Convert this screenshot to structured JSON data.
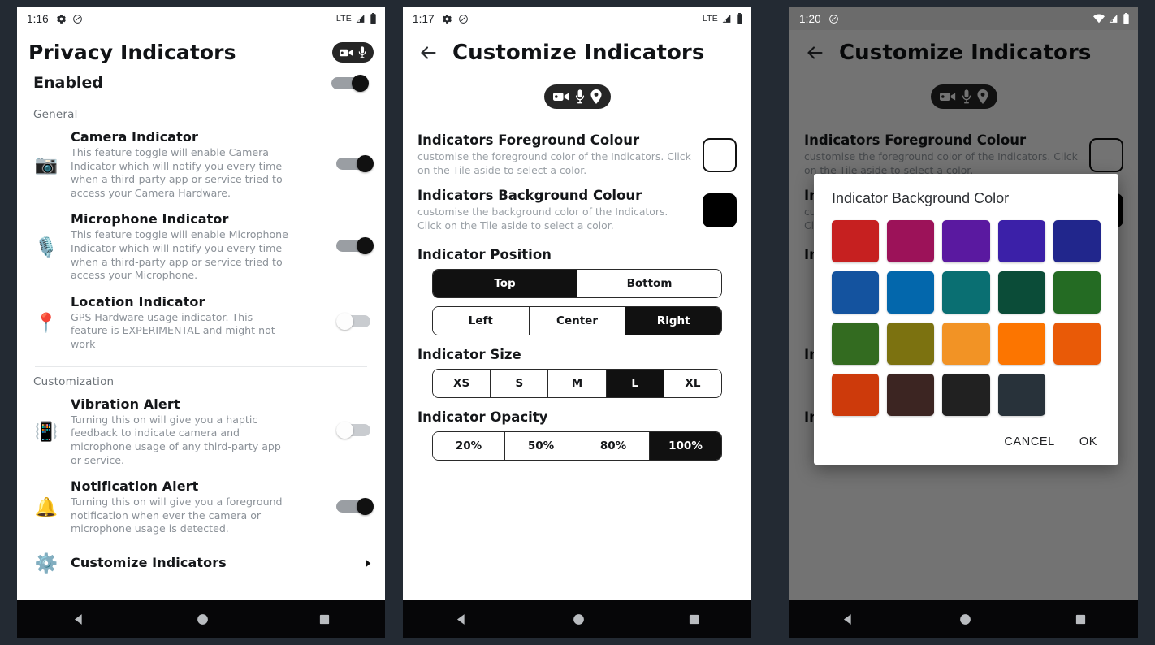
{
  "panels": {
    "one": {
      "status": {
        "time": "1:16",
        "network": "LTE",
        "icons": [
          "gear-icon",
          "nfc-icon",
          "signal-icon",
          "battery-icon"
        ]
      },
      "appbar": {
        "title": "Privacy Indicators",
        "pill_icons": [
          "camera-icon",
          "microphone-icon"
        ]
      },
      "enabled": {
        "label": "Enabled",
        "state": "on"
      },
      "sections": [
        {
          "label": "General",
          "items": [
            {
              "icon": "camera-emoji",
              "title": "Camera Indicator",
              "desc": "This feature toggle will enable Camera Indicator which will notify you every time when a third-party app or service tried to access your Camera Hardware.",
              "state": "on"
            },
            {
              "icon": "microphone-emoji",
              "title": "Microphone Indicator",
              "desc": "This feature toggle will enable Microphone Indicator which will notify you every time when a third-party app or service tried to access your Microphone.",
              "state": "on"
            },
            {
              "icon": "location-pin-emoji",
              "title": "Location Indicator",
              "desc": "GPS Hardware usage indicator. This feature is EXPERIMENTAL and might not work",
              "state": "off"
            }
          ]
        },
        {
          "label": "Customization",
          "items": [
            {
              "icon": "vibrating-phone-emoji",
              "title": "Vibration Alert",
              "desc": "Turning this on will give you a haptic feedback to indicate camera and microphone usage of any third-party app or service.",
              "state": "off"
            },
            {
              "icon": "bell-emoji",
              "title": "Notification Alert",
              "desc": "Turning this on will give you a foreground notification when ever the camera or microphone usage is detected.",
              "state": "on"
            }
          ]
        }
      ],
      "last_row": {
        "title": "Customize Indicators"
      }
    },
    "two": {
      "status": {
        "time": "1:17",
        "network": "LTE"
      },
      "appbar": {
        "title": "Customize Indicators",
        "back": "back-arrow"
      },
      "preview_pill_icons": [
        "camera-icon",
        "microphone-icon",
        "location-icon"
      ],
      "foreground": {
        "title": "Indicators Foreground Colour",
        "desc": "customise the foreground color of the Indicators. Click on the Tile aside to select a color.",
        "swatch": "#ffffff"
      },
      "background": {
        "title": "Indicators Background Colour",
        "desc": "customise the background color of the Indicators. Click on the Tile aside to select a color.",
        "swatch": "#000000"
      },
      "position": {
        "title": "Indicator Position",
        "vertical": {
          "options": [
            "Top",
            "Bottom"
          ],
          "selected": "Top"
        },
        "horizontal": {
          "options": [
            "Left",
            "Center",
            "Right"
          ],
          "selected": "Right"
        }
      },
      "size": {
        "title": "Indicator Size",
        "options": [
          "XS",
          "S",
          "M",
          "L",
          "XL"
        ],
        "selected": "L"
      },
      "opacity": {
        "title": "Indicator Opacity",
        "options": [
          "20%",
          "50%",
          "80%",
          "100%"
        ],
        "selected": "100%"
      }
    },
    "three": {
      "status": {
        "time": "1:20",
        "network": "wifi",
        "icons": [
          "nfc-icon",
          "wifi-icon",
          "signal-icon",
          "battery-icon"
        ]
      },
      "appbar": {
        "title": "Customize Indicators",
        "back": "back-arrow"
      },
      "dialog": {
        "title": "Indicator Background Color",
        "cancel_label": "CANCEL",
        "ok_label": "OK",
        "swatches": [
          "#c62020",
          "#9c1259",
          "#5a19a0",
          "#3b20a8",
          "#21268c",
          "#14539f",
          "#0367ac",
          "#0a6f72",
          "#0b4c38",
          "#246b23",
          "#336b20",
          "#7c7210",
          "#f29325",
          "#fc7500",
          "#e95a07",
          "#cd3a0b",
          "#3c2522",
          "#212121",
          "#28323a"
        ]
      }
    }
  },
  "navbar": {
    "items": [
      "back-triangle-icon",
      "home-circle-icon",
      "recents-square-icon"
    ]
  }
}
